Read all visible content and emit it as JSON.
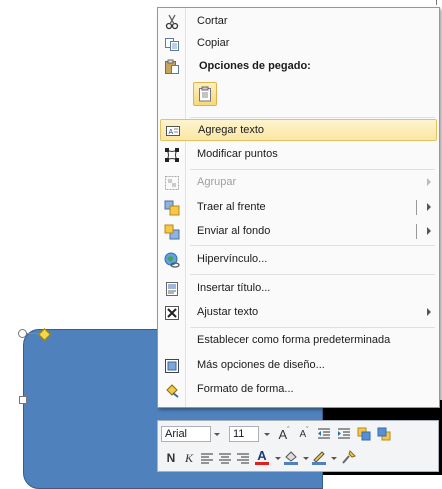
{
  "menu": {
    "items": [
      {
        "label": "Cortar",
        "icon": "scissors-icon"
      },
      {
        "label": "Copiar",
        "icon": "copy-icon"
      },
      {
        "label": "Opciones de pegado:",
        "icon": "paste-options-icon"
      },
      {
        "label": "Agregar texto",
        "icon": "add-text-icon"
      },
      {
        "label": "Modificar puntos",
        "icon": "edit-points-icon"
      },
      {
        "label": "Agrupar",
        "icon": "group-icon"
      },
      {
        "label": "Traer al frente",
        "icon": "bring-to-front-icon"
      },
      {
        "label": "Enviar al fondo",
        "icon": "send-to-back-icon"
      },
      {
        "label": "Hipervínculo...",
        "icon": "hyperlink-icon"
      },
      {
        "label": "Insertar título...",
        "icon": "insert-caption-icon"
      },
      {
        "label": "Ajustar texto",
        "icon": "wrap-text-icon"
      },
      {
        "label": "Establecer como forma predeterminada"
      },
      {
        "label": "Más opciones de diseño...",
        "icon": "layout-options-icon"
      },
      {
        "label": "Formato de forma...",
        "icon": "format-shape-icon"
      }
    ]
  },
  "toolbar": {
    "font_name": "Arial",
    "font_size": "11",
    "grow_font": "A",
    "shrink_font": "A",
    "bold": "N",
    "italic": "K",
    "font_color_letter": "A",
    "colors": {
      "font_color": "#e02020",
      "highlight": "#ffff00",
      "fill": "#4f81bd",
      "shape_fill": "#4f81bd"
    }
  }
}
